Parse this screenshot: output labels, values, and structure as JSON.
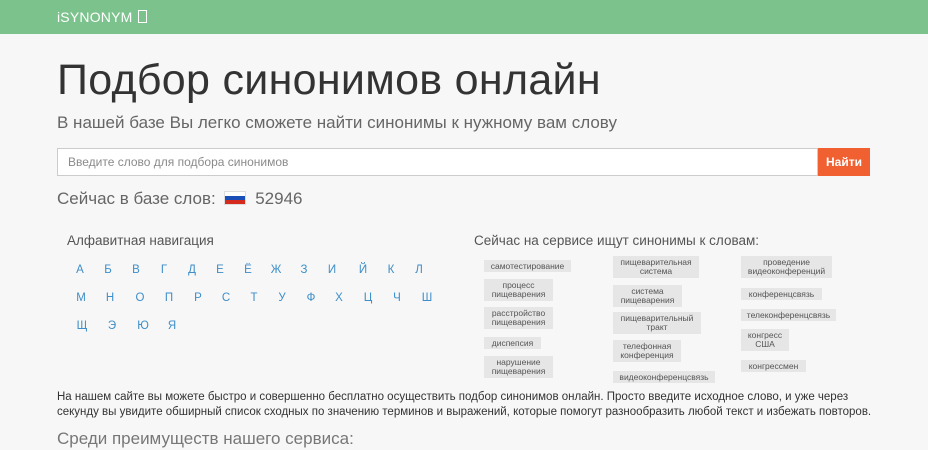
{
  "header": {
    "brand": "iSYNONYM"
  },
  "main": {
    "title": "Подбор синонимов онлайн",
    "subtitle": "В нашей базе Вы легко сможете найти синонимы к нужному вам слову",
    "search": {
      "placeholder": "Введите слово для подбора синонимов",
      "value": "",
      "button": "Найти"
    },
    "count_label": "Сейчас в базе слов:",
    "count_value": "52946",
    "alphabet_heading": "Алфавитная навигация",
    "alphabet": [
      "А",
      "Б",
      "В",
      "Г",
      "Д",
      "Е",
      "Ё",
      "Ж",
      "З",
      "И",
      "Й",
      "К",
      "Л",
      "М",
      "Н",
      "О",
      "П",
      "Р",
      "С",
      "Т",
      "У",
      "Ф",
      "Х",
      "Ц",
      "Ч",
      "Ш",
      "Щ",
      "Э",
      "Ю",
      "Я"
    ],
    "searching_heading": "Сейчас на сервисе ищут синонимы к словам:",
    "tags": [
      "самотестирование",
      "процесс пищеварения",
      "расстройство пищеварения",
      "диспепсия",
      "нарушение пищеварения",
      "пищеварительная система",
      "система пищеварения",
      "пищеварительный тракт",
      "телефонная конференция",
      "видеоконференцсвязь",
      "проведение видеоконференций",
      "конференцсвязь",
      "телеконференцсвязь",
      "конгресс США",
      "конгрессмен"
    ],
    "description": "На нашем сайте вы можете быстро и совершенно бесплатно осуществить подбор синонимов онлайн. Просто введите исходное слово, и уже через секунду вы увидите обширный список сходных по значению терминов и выражений, которые помогут разнообразить любой текст и избежать повторов.",
    "advantages_heading": "Среди преимуществ нашего сервиса:"
  },
  "colors": {
    "topbar": "#7cc28d",
    "search_button": "#f06030",
    "link": "#3d8ec9"
  }
}
